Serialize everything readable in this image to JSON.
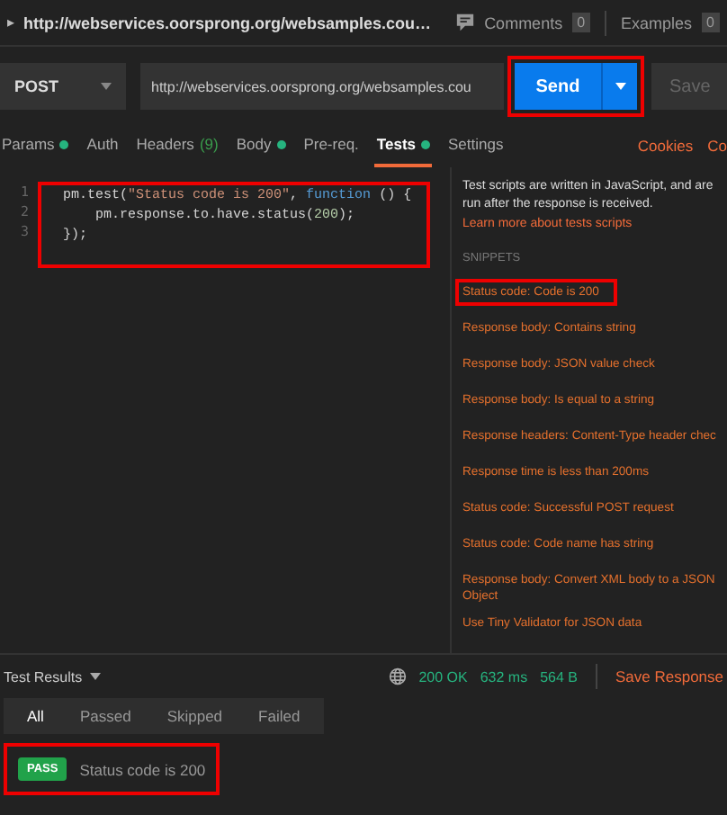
{
  "header": {
    "expand_icon": "▸",
    "title": "http://webservices.oorsprong.org/websamples.cou…",
    "comments_label": "Comments",
    "comments_count": "0",
    "examples_label": "Examples",
    "examples_count": "0"
  },
  "request": {
    "method": "POST",
    "url": "http://webservices.oorsprong.org/websamples.cou",
    "send_label": "Send",
    "send_highlighted": true,
    "save_label": "Save"
  },
  "tabs": [
    {
      "label": "Params",
      "dot": true,
      "selected": false
    },
    {
      "label": "Auth",
      "dot": false,
      "selected": false
    },
    {
      "label": "Headers",
      "dot": false,
      "count": "(9)",
      "selected": false
    },
    {
      "label": "Body",
      "dot": true,
      "selected": false
    },
    {
      "label": "Pre-req.",
      "dot": false,
      "selected": false
    },
    {
      "label": "Tests",
      "dot": true,
      "selected": true
    },
    {
      "label": "Settings",
      "dot": false,
      "selected": false
    }
  ],
  "tab_links": [
    "Cookies",
    "Co"
  ],
  "editor": {
    "highlighted": true,
    "lines": [
      {
        "number": "1",
        "tokens": [
          {
            "text": "pm.test(",
            "kind": "plain"
          },
          {
            "text": "\"Status code is 200\"",
            "kind": "string"
          },
          {
            "text": ", ",
            "kind": "plain"
          },
          {
            "text": "function",
            "kind": "keyword"
          },
          {
            "text": " () {",
            "kind": "plain"
          }
        ]
      },
      {
        "number": "2",
        "tokens": [
          {
            "text": "    pm.response.to.have.status(",
            "kind": "plain"
          },
          {
            "text": "200",
            "kind": "number"
          },
          {
            "text": ");",
            "kind": "plain"
          }
        ]
      },
      {
        "number": "3",
        "tokens": [
          {
            "text": "});",
            "kind": "plain"
          }
        ]
      }
    ]
  },
  "snippets_panel": {
    "intro": "Test scripts are written in JavaScript, and are run after the response is received.",
    "learn_link": "Learn more about tests scripts",
    "heading": "SNIPPETS",
    "items": [
      {
        "label": "Status code: Code is 200",
        "highlighted": true
      },
      {
        "label": "Response body: Contains string",
        "highlighted": false
      },
      {
        "label": "Response body: JSON value check",
        "highlighted": false
      },
      {
        "label": "Response body: Is equal to a string",
        "highlighted": false
      },
      {
        "label": "Response headers: Content-Type header chec",
        "highlighted": false
      },
      {
        "label": "Response time is less than 200ms",
        "highlighted": false
      },
      {
        "label": "Status code: Successful POST request",
        "highlighted": false
      },
      {
        "label": "Status code: Code name has string",
        "highlighted": false
      },
      {
        "label": "Response body: Convert XML body to a JSON Object",
        "highlighted": false
      },
      {
        "label": "Use Tiny Validator for JSON data",
        "highlighted": false
      }
    ]
  },
  "response_bar": {
    "title": "Test Results",
    "status": "200 OK",
    "time": "632 ms",
    "size": "564 B",
    "save_label": "Save Response"
  },
  "filters": [
    {
      "label": "All",
      "selected": true
    },
    {
      "label": "Passed",
      "selected": false
    },
    {
      "label": "Skipped",
      "selected": false
    },
    {
      "label": "Failed",
      "selected": false
    }
  ],
  "results": [
    {
      "badge": "PASS",
      "name": "Status code is 200",
      "highlighted": true
    }
  ]
}
